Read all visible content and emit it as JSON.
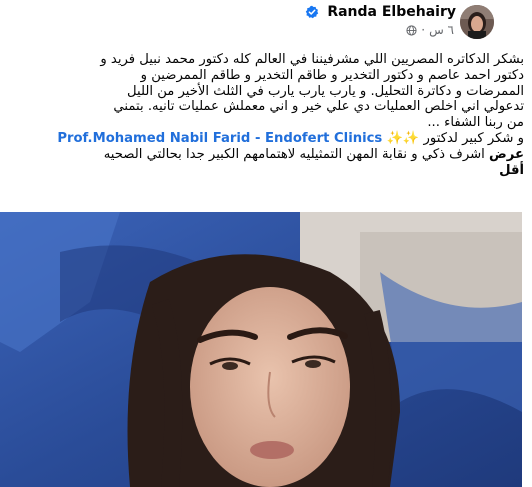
{
  "post": {
    "author": "Randa Elbehairy",
    "time": "٦ س",
    "separator": "·",
    "text_line1": "بشكر الدكاتره المصريين اللي مشرفيننا في العالم كله دكتور محمد نبيل فريد و",
    "text_line2": "دكتور احمد عاصم و دكتور التخدير و طاقم التخدير و طاقم الممرضين و",
    "text_line3": "الممرضات و دكاترة التحليل.  و يارب يارب يارب  في الثلث الأخير من الليل",
    "text_line4": "تدعولي اني اخلص العمليات دي علي خير و اني معملش عمليات تانيه. بتمني",
    "text_line5": "من ربنا الشفاء ...",
    "thanks_prefix": "و شكر كبير لدكتور",
    "sparkles": "✨✨",
    "mention": "Prof.Mohamed Nabil Farid - Endofert Clinics",
    "text_line7": "اشرف ذكي و نقابة المهن التمثيليه  لاهتمامهم الكبير جدا بحالتي الصحيه",
    "see_more_1": "عرض",
    "see_more_2": "أقل"
  },
  "icons": {
    "verified": "verified-badge-icon",
    "audience": "globe-icon"
  },
  "colors": {
    "link": "#216fdb",
    "verified": "#1877f2",
    "meta": "#65676b",
    "blanket": "#2c4f9c"
  }
}
